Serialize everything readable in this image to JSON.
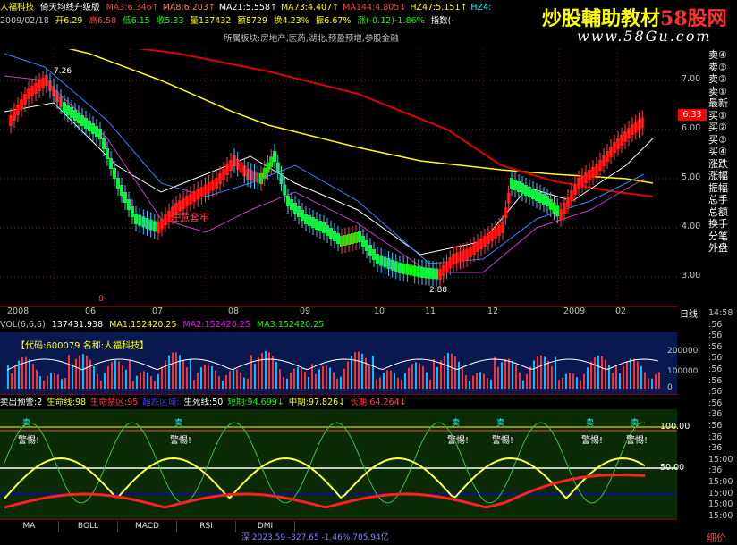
{
  "header": {
    "title": "人福科技",
    "indicator_name": "倚天均线升级版",
    "ma_values": [
      {
        "label": "MA3",
        "value": "6.346",
        "arrow": "↑",
        "color": "#ff4040"
      },
      {
        "label": "MA8",
        "value": "6.203",
        "arrow": "↑",
        "color": "#ff8040"
      },
      {
        "label": "MA21",
        "value": "5.558",
        "arrow": "↑",
        "color": "#ffffff"
      },
      {
        "label": "MA73",
        "value": "4.407",
        "arrow": "↑",
        "color": "#ffff00"
      },
      {
        "label": "MA144",
        "value": "4.805",
        "arrow": "↓",
        "color": "#ff4040"
      },
      {
        "label": "HZ47",
        "value": "5.151",
        "arrow": "↑",
        "color": "#ffff00"
      },
      {
        "label": "HZ4",
        "value": "",
        "arrow": "",
        "color": "#00ffff"
      }
    ],
    "quote_line": {
      "date": "2009/02/18",
      "open": "开6.29",
      "high": "高6.58",
      "low": "低6.15",
      "close": "收5.33",
      "volume": "量137432",
      "amount": "额8729",
      "turnover": "换4.23%",
      "amplitude": "振6.67%",
      "change": "涨(-0.12)-1.86%",
      "index": "指数(-"
    },
    "sector_line": "所属板块:房地产,医药,湖北,预盈预增,参股金融"
  },
  "watermark": {
    "main": "炒股輔助教材",
    "brand": "58股网",
    "url": "www.58Gu.com"
  },
  "price_chart": {
    "annotations": {
      "high_label": "7.26",
      "low_label": "2.88",
      "text_in_chart": "注意套牢",
      "current_price": "6.33",
      "sell_marker": "8"
    },
    "y_ticks": [
      "7.00",
      "6.00",
      "5.00",
      "4.00",
      "3.00"
    ],
    "x_ticks": [
      "2008",
      "06",
      "07",
      "08",
      "09",
      "10",
      "11",
      "12",
      "2009",
      "02"
    ],
    "period_label": "日线"
  },
  "side_panel": [
    "卖④",
    "卖③",
    "卖②",
    "卖①",
    "最新",
    "买①",
    "买②",
    "买③",
    "买④",
    "涨跌",
    "涨幅",
    "振幅",
    "总手",
    "总额",
    "换手",
    "分笔",
    "外盘"
  ],
  "volume_pane": {
    "header": {
      "label": "VOL(6,6,6)",
      "vol": "137431.938",
      "ma1": "MA1:152420.25",
      "ma2": "MA2:152420.25",
      "ma3": "MA3:152420.25"
    },
    "stock_info": "【代码:600079 名称:人福科技】",
    "y_ticks": [
      "200000",
      "100000",
      "0"
    ]
  },
  "indicator_pane": {
    "header": [
      {
        "text": "卖出预警:2",
        "color": "#ffffff"
      },
      {
        "text": "生命线:98",
        "color": "#ffff00"
      },
      {
        "text": "生命禁区:95",
        "color": "#ff4040"
      },
      {
        "text": "超跌区域:",
        "color": "#4040ff"
      },
      {
        "text": "生死线:50",
        "color": "#ffffff"
      },
      {
        "text": "短期:94.699↓",
        "color": "#00ff00"
      },
      {
        "text": "中期:97.826↓",
        "color": "#ffff00"
      },
      {
        "text": "长期:64.264↓",
        "color": "#ff4040"
      }
    ],
    "y_ticks": [
      "100.00",
      "50.00"
    ],
    "marker_text": "警惕",
    "marker_top": "卖"
  },
  "tabs": [
    "MA",
    "BOLL",
    "MACD",
    "RSI",
    "DMI"
  ],
  "right_axis_clock": [
    "14:58",
    ":56",
    ":56",
    ":56",
    ":56",
    ":56",
    ":56",
    ":56",
    ":56",
    ":36",
    ":56",
    ":36",
    ":36",
    "15:00",
    ":36",
    "15:00",
    "15:00",
    "15:00",
    "15:00"
  ],
  "status_bar": "深 2023.59 -327.65 -1.46% 705.94亿",
  "bottom_right": "细价"
}
